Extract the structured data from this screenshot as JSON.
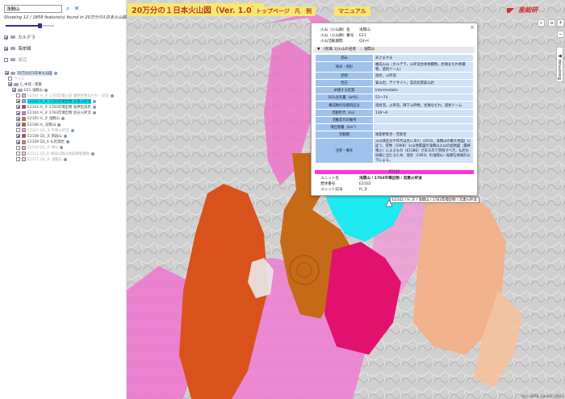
{
  "search": {
    "value": "浅間山",
    "placeholder": ""
  },
  "showing": "Showing 12 / 1859 feature(s) found in 20万分の1日本火山図",
  "opacity": 0.7,
  "layers": {
    "caldera": "カルデラ",
    "coastline": "海岸線",
    "lakes": "湖沼",
    "main": "20万分の1日本火山図",
    "label": "ラベル",
    "region": "E_中部・関東",
    "volcano": "E21 浅間山"
  },
  "units": [
    {
      "label": "E2101 H_ヌ 1783年噴火前 鎌原岩屑なだれ・泥流",
      "color": "#e0b0e8",
      "checked": false,
      "highlight": false
    },
    {
      "label": "E2102 H_ヌ 1783年噴出物 吾妻火砕流",
      "color": "#00e5ff",
      "checked": true,
      "highlight": true
    },
    {
      "label": "E2103 H_ヌ 1783年噴出物 鬼押出溶岩",
      "color": "#e0107a",
      "checked": true,
      "highlight": false
    },
    {
      "label": "E2104 H_ヌ 1783年噴出物 追分火砕流",
      "color": "#f06ec8",
      "checked": true,
      "highlight": false
    },
    {
      "label": "E2105 H_ヌ 浅間山",
      "color": "#c47a1a",
      "checked": true,
      "highlight": false
    },
    {
      "label": "E2106 H_ 前掛山",
      "color": "#d4501c",
      "checked": true,
      "highlight": false
    },
    {
      "label": "E2107 Q3_ヌ 平原火砕流",
      "color": "#f0a0d8",
      "checked": false,
      "highlight": false
    },
    {
      "label": "E2108 Q3_ヌ 黒斑山",
      "color": "#c0306a",
      "checked": true,
      "highlight": false
    },
    {
      "label": "E2109 Q3_A 仏岩溶岩",
      "color": "#e87060",
      "checked": true,
      "highlight": false
    },
    {
      "label": "E2110 Q3_ヌ 塚山",
      "color": "#f4b08a",
      "checked": false,
      "highlight": false
    },
    {
      "label": "E2111 Q3_D 黒斑山期山体崩壊堆積物",
      "color": "#f8c4e0",
      "checked": false,
      "highlight": false
    },
    {
      "label": "E2112 Q3_ヌ 浅間石",
      "color": "#f2d0e6",
      "checked": false,
      "highlight": false
    }
  ],
  "header": {
    "title": "20万分の１日本火山図（Ver. 1.0）",
    "nav_top": "トップページ",
    "nav_legend": "凡　例",
    "nav_manual": "マニュアル",
    "logo": "産総研"
  },
  "controls": {
    "zoom_in": "+",
    "zoom_out": "−",
    "basemap": "Basemap ▲"
  },
  "popup": {
    "close": "×",
    "head": [
      {
        "k": "火山（火山群）名",
        "v": "浅間山"
      },
      {
        "k": "火山（火山群）番号",
        "v": "E21"
      },
      {
        "k": "火山活動期間",
        "v": "Q3-H"
      }
    ],
    "section": "▼　[所属 1]火山の名称　：浅間山",
    "rows": [
      {
        "k": "読み",
        "v": "あさまやま"
      },
      {
        "k": "様式・地形",
        "v": "複成火山（カルデラ，火砕流台地堆積物，岩屑なだれ堆積物，溶岩ドーム）"
      },
      {
        "k": "岩相",
        "v": "溶岩，火砕流"
      },
      {
        "k": "岩石",
        "v": "安山岩，デイサイト，玄武岩質安山岩"
      },
      {
        "k": "卓越する岩質",
        "v": "Intermediate"
      },
      {
        "k": "SiO₂含有量（wt%）",
        "v": "52〜74"
      },
      {
        "k": "構成物の形態的区分",
        "v": "溶岩流，火砕流，降下火砕物，岩屑なだれ，溶岩ドーム"
      },
      {
        "k": "活動年代（ka）",
        "v": "130〜0"
      },
      {
        "k": "活動年代の備考",
        "v": ""
      },
      {
        "k": "噴出物量（km³）",
        "v": ""
      },
      {
        "k": "活動期",
        "v": "後期更新世・完新世"
      },
      {
        "k": "注釈・備考",
        "v": "火山体区分や年代は主に早川（2010，浅間山の概大地図）に従う。荒牧（1968）火山地質図の浅間山火山の副地図（最終噴火）によるもの（E1386）があるので参照すべき。仏岩も同様に当たるため．溶岩（1963）の浅間山−浅間石地域の以下による。"
      }
    ],
    "pink": "E2102",
    "unit": [
      {
        "k": "ユニット名",
        "v": "浅間山 / 1783年噴出物 / 吾妻火砕流"
      },
      {
        "k": "岩体番号",
        "v": "E2102"
      },
      {
        "k": "ユニット記号",
        "v": "H_ヌ"
      }
    ]
  },
  "map_label": "E2102 / H_ヌ / 浅間山 / 1783年噴出物 / 吾妻火砕流",
  "attribution": "Esri, HERE, Garmin, USGS"
}
